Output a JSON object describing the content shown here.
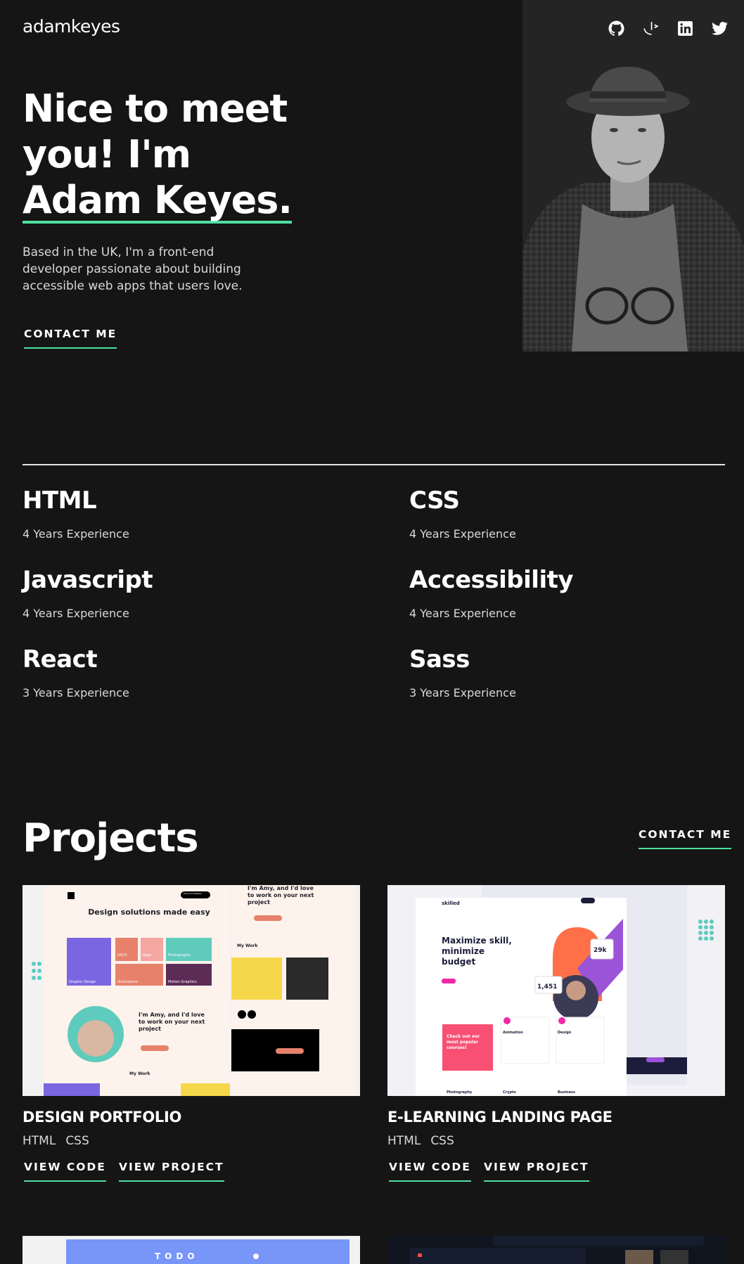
{
  "header": {
    "logo": "adamkeyes",
    "social": [
      "github-icon",
      "frontend-mentor-icon",
      "linkedin-icon",
      "twitter-icon"
    ]
  },
  "hero": {
    "title_line1": "Nice to meet",
    "title_line2": "you! I'm",
    "title_name": "Adam Keyes.",
    "intro": "Based in the UK, I'm a front-end developer passionate about building accessible web apps that users love.",
    "contact_label": "CONTACT ME"
  },
  "skills": [
    {
      "name": "HTML",
      "experience": "4 Years Experience"
    },
    {
      "name": "CSS",
      "experience": "4 Years Experience"
    },
    {
      "name": "Javascript",
      "experience": "4 Years Experience"
    },
    {
      "name": "Accessibility",
      "experience": "4 Years Experience"
    },
    {
      "name": "React",
      "experience": "3 Years Experience"
    },
    {
      "name": "Sass",
      "experience": "3 Years Experience"
    }
  ],
  "projects": {
    "title": "Projects",
    "contact_label": "CONTACT ME",
    "items": [
      {
        "title": "DESIGN PORTFOLIO",
        "tags": [
          "HTML",
          "CSS"
        ],
        "view_code": "VIEW CODE",
        "view_project": "VIEW PROJECT",
        "preview": {
          "heading": "Design solutions made easy",
          "tiles": [
            "UI/UX",
            "Apps",
            "Photography",
            "Graphic Design",
            "Illustrations",
            "Motion Graphics"
          ],
          "intro": "I'm Amy, and I'd love to work on your next project",
          "section": "My Work",
          "button": "Free Consultation"
        }
      },
      {
        "title": "E-LEARNING LANDING PAGE",
        "tags": [
          "HTML",
          "CSS"
        ],
        "view_code": "VIEW CODE",
        "view_project": "VIEW PROJECT",
        "preview": {
          "brand": "skilled",
          "heading": "Maximize skill, minimize budget",
          "cta": "Check out our most popular courses!",
          "stat1": "29k",
          "stat2": "1,451",
          "courses": [
            "Animation",
            "Design",
            "Photography",
            "Crypto",
            "Business"
          ]
        }
      }
    ],
    "partial": {
      "todo": "TODO"
    }
  },
  "colors": {
    "background": "#151515",
    "panel": "#242424",
    "accent": "#4ee1a0",
    "text": "#ffffff",
    "muted": "#d9d9d9"
  }
}
